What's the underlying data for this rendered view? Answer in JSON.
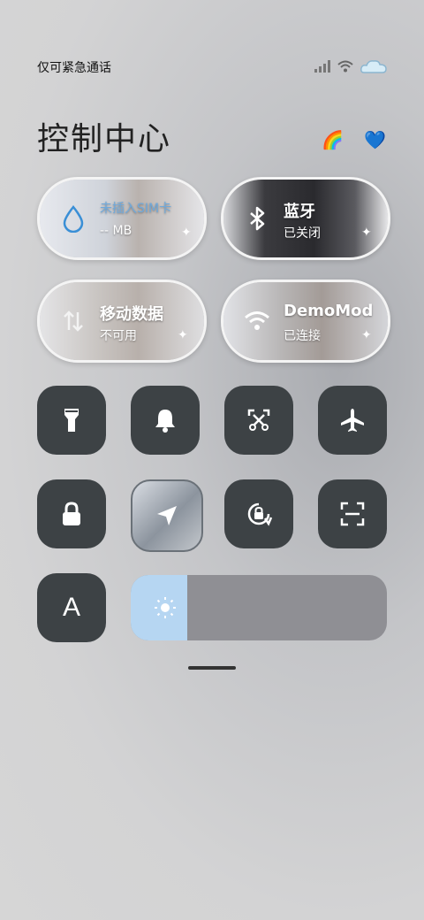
{
  "status": {
    "carrier_text": "仅可紧急通话"
  },
  "header": {
    "title": "控制中心",
    "emoji_left": "🌈",
    "emoji_right": "💙"
  },
  "tiles": [
    {
      "label": "未插入SIM卡",
      "sub": "-- MB",
      "icon": "water-drop-icon"
    },
    {
      "label": "蓝牙",
      "sub": "已关闭",
      "icon": "bluetooth-icon"
    },
    {
      "label": "移动数据",
      "sub": "不可用",
      "icon": "mobile-data-icon"
    },
    {
      "label": "DemoMod",
      "sub": "已连接",
      "icon": "wifi-icon"
    }
  ],
  "buttons": [
    {
      "name": "flashlight",
      "icon": "flashlight-icon"
    },
    {
      "name": "bell",
      "icon": "bell-icon"
    },
    {
      "name": "screenshot",
      "icon": "scissors-screenshot-icon"
    },
    {
      "name": "airplane",
      "icon": "airplane-icon"
    },
    {
      "name": "lock",
      "icon": "lock-icon"
    },
    {
      "name": "location",
      "icon": "location-arrow-icon"
    },
    {
      "name": "rotation-lock",
      "icon": "rotation-lock-icon"
    },
    {
      "name": "scan",
      "icon": "scan-icon"
    },
    {
      "name": "font",
      "icon": "font-icon",
      "text": "A"
    }
  ],
  "brightness": {
    "level": 0.22,
    "icon": "sun-icon"
  },
  "colors": {
    "button_bg": "#3d4245",
    "slider_fill": "#b6d6f2",
    "slider_bg": "#8f8f94"
  }
}
